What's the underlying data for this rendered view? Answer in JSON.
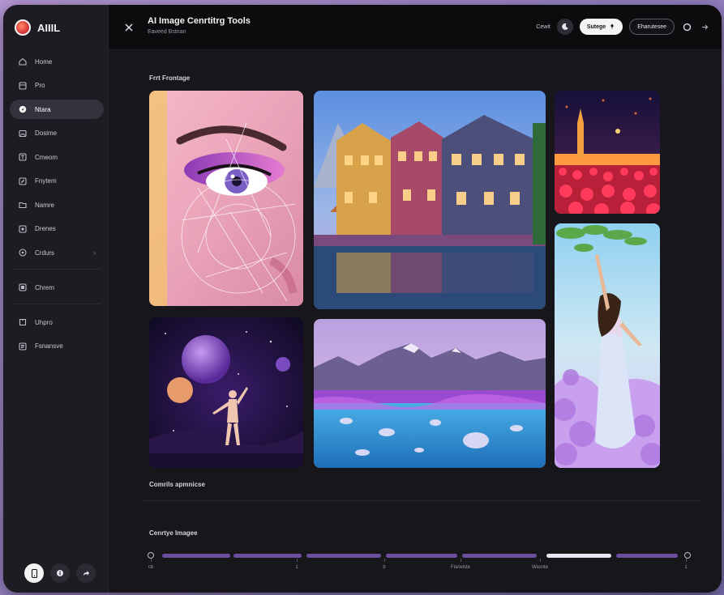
{
  "app": {
    "brand": "AIIIL"
  },
  "sidebar": {
    "items": [
      {
        "label": "Home",
        "icon": "home-icon"
      },
      {
        "label": "Pro",
        "icon": "grid-icon"
      },
      {
        "label": "Ntara",
        "icon": "compass-icon",
        "active": true
      },
      {
        "label": "Dosime",
        "icon": "image-icon"
      },
      {
        "label": "Cmeom",
        "icon": "text-icon"
      },
      {
        "label": "Fnytem",
        "icon": "edit-icon"
      },
      {
        "label": "Namre",
        "icon": "folder-icon"
      },
      {
        "label": "Drenes",
        "icon": "layers-icon"
      },
      {
        "label": "Crdurs",
        "icon": "globe-icon",
        "has_chevron": true
      },
      {
        "label": "Chrem",
        "icon": "media-icon"
      },
      {
        "label": "Uhpro",
        "icon": "book-icon"
      },
      {
        "label": "Fsnansve",
        "icon": "settings-icon"
      }
    ],
    "bottom_buttons": [
      "device-icon",
      "info-icon",
      "share-icon"
    ]
  },
  "header": {
    "title": "AI Image Cenrtitrg Tools",
    "subtitle": "Eaveed Bstnan",
    "links": {
      "link1": "Cewit"
    },
    "primary_button": "Sutege",
    "secondary_button": "Eharutesee"
  },
  "main": {
    "section1_label": "Frrt Frontage",
    "section2_label": "Comrils apmnicse",
    "section3_label": "Cenrtye Imagee",
    "gallery": [
      {
        "name": "face-portrait-tile",
        "desc": "face"
      },
      {
        "name": "colorful-houses-tile",
        "desc": "houses"
      },
      {
        "name": "tulip-field-tile",
        "desc": "tulips"
      },
      {
        "name": "cosmic-dancer-tile",
        "desc": "dancer"
      },
      {
        "name": "purple-mountains-tile",
        "desc": "mountains"
      },
      {
        "name": "woman-flowers-tile",
        "desc": "woman"
      }
    ]
  },
  "timeline": {
    "labels": [
      "cb",
      "1",
      "b",
      "Flarwlste",
      "Wasnte",
      "1"
    ]
  },
  "colors": {
    "accent": "#6b4f9e",
    "highlight": "#e9e6f2",
    "background": "#16161b",
    "sidebar": "#1c1c22"
  }
}
